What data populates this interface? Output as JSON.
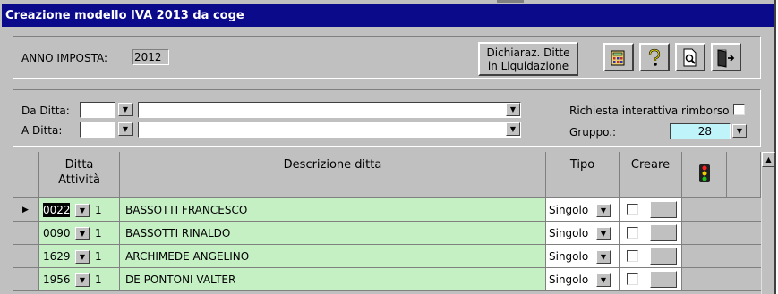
{
  "window": {
    "title": "Creazione modello IVA 2013 da coge"
  },
  "toolbar": {
    "anno_label": "ANNO IMPOSTA:",
    "anno_value": "2012",
    "dichiaraz_line1": "Dichiaraz. Ditte",
    "dichiaraz_line2": "in Liquidazione",
    "icons": [
      "calculator-icon",
      "help-icon",
      "print-preview-icon",
      "exit-door-icon"
    ]
  },
  "filters": {
    "da_ditta_label": "Da Ditta:",
    "da_ditta_code": "",
    "da_ditta_desc": "",
    "a_ditta_label": "A Ditta:",
    "a_ditta_code": "",
    "a_ditta_desc": "",
    "rimborso_label": "Richiesta interattiva rimborso",
    "rimborso_checked": false,
    "gruppo_label": "Gruppo.:",
    "gruppo_value": "28"
  },
  "grid": {
    "headers": {
      "ditta_line1": "Ditta",
      "ditta_line2": "Attività",
      "descrizione": "Descrizione ditta",
      "tipo": "Tipo",
      "creare": "Creare",
      "semaforo": "traffic-light-icon"
    },
    "rows": [
      {
        "code": "0022",
        "attivita": "1",
        "descrizione": "BASSOTTI FRANCESCO",
        "tipo": "Singolo",
        "creare": false,
        "current": true
      },
      {
        "code": "0090",
        "attivita": "1",
        "descrizione": "BASSOTTI RINALDO",
        "tipo": "Singolo",
        "creare": false,
        "current": false
      },
      {
        "code": "1629",
        "attivita": "1",
        "descrizione": "ARCHIMEDE ANGELINO",
        "tipo": "Singolo",
        "creare": false,
        "current": false
      },
      {
        "code": "1956",
        "attivita": "1",
        "descrizione": "DE PONTONI VALTER",
        "tipo": "Singolo",
        "creare": false,
        "current": false
      }
    ]
  },
  "colors": {
    "title_bg": "#0a0a8a",
    "row_bg": "#c4f0c4",
    "gruppo_bg": "#bff4fb",
    "window_bg": "#c0c0c0"
  }
}
